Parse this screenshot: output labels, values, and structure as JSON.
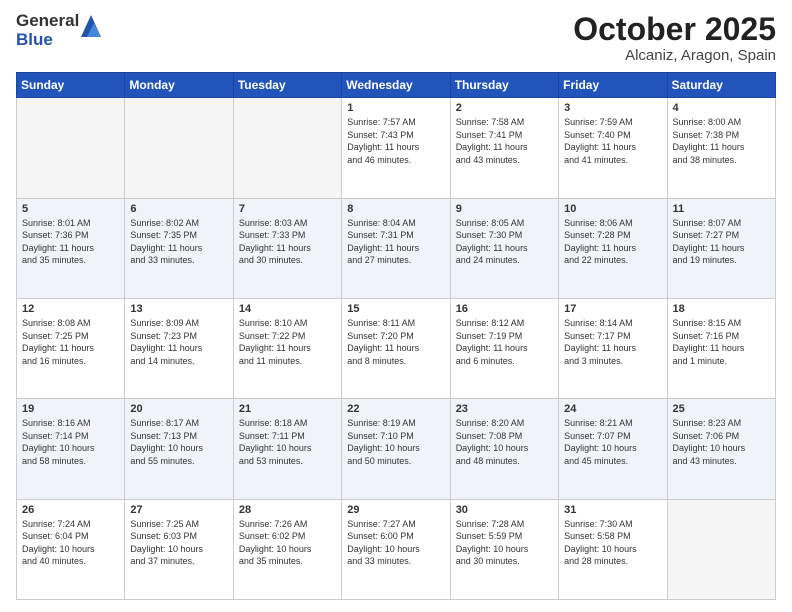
{
  "logo": {
    "general": "General",
    "blue": "Blue"
  },
  "title": {
    "month": "October 2025",
    "location": "Alcaniz, Aragon, Spain"
  },
  "weekdays": [
    "Sunday",
    "Monday",
    "Tuesday",
    "Wednesday",
    "Thursday",
    "Friday",
    "Saturday"
  ],
  "weeks": [
    [
      {
        "day": "",
        "info": ""
      },
      {
        "day": "",
        "info": ""
      },
      {
        "day": "",
        "info": ""
      },
      {
        "day": "1",
        "info": "Sunrise: 7:57 AM\nSunset: 7:43 PM\nDaylight: 11 hours\nand 46 minutes."
      },
      {
        "day": "2",
        "info": "Sunrise: 7:58 AM\nSunset: 7:41 PM\nDaylight: 11 hours\nand 43 minutes."
      },
      {
        "day": "3",
        "info": "Sunrise: 7:59 AM\nSunset: 7:40 PM\nDaylight: 11 hours\nand 41 minutes."
      },
      {
        "day": "4",
        "info": "Sunrise: 8:00 AM\nSunset: 7:38 PM\nDaylight: 11 hours\nand 38 minutes."
      }
    ],
    [
      {
        "day": "5",
        "info": "Sunrise: 8:01 AM\nSunset: 7:36 PM\nDaylight: 11 hours\nand 35 minutes."
      },
      {
        "day": "6",
        "info": "Sunrise: 8:02 AM\nSunset: 7:35 PM\nDaylight: 11 hours\nand 33 minutes."
      },
      {
        "day": "7",
        "info": "Sunrise: 8:03 AM\nSunset: 7:33 PM\nDaylight: 11 hours\nand 30 minutes."
      },
      {
        "day": "8",
        "info": "Sunrise: 8:04 AM\nSunset: 7:31 PM\nDaylight: 11 hours\nand 27 minutes."
      },
      {
        "day": "9",
        "info": "Sunrise: 8:05 AM\nSunset: 7:30 PM\nDaylight: 11 hours\nand 24 minutes."
      },
      {
        "day": "10",
        "info": "Sunrise: 8:06 AM\nSunset: 7:28 PM\nDaylight: 11 hours\nand 22 minutes."
      },
      {
        "day": "11",
        "info": "Sunrise: 8:07 AM\nSunset: 7:27 PM\nDaylight: 11 hours\nand 19 minutes."
      }
    ],
    [
      {
        "day": "12",
        "info": "Sunrise: 8:08 AM\nSunset: 7:25 PM\nDaylight: 11 hours\nand 16 minutes."
      },
      {
        "day": "13",
        "info": "Sunrise: 8:09 AM\nSunset: 7:23 PM\nDaylight: 11 hours\nand 14 minutes."
      },
      {
        "day": "14",
        "info": "Sunrise: 8:10 AM\nSunset: 7:22 PM\nDaylight: 11 hours\nand 11 minutes."
      },
      {
        "day": "15",
        "info": "Sunrise: 8:11 AM\nSunset: 7:20 PM\nDaylight: 11 hours\nand 8 minutes."
      },
      {
        "day": "16",
        "info": "Sunrise: 8:12 AM\nSunset: 7:19 PM\nDaylight: 11 hours\nand 6 minutes."
      },
      {
        "day": "17",
        "info": "Sunrise: 8:14 AM\nSunset: 7:17 PM\nDaylight: 11 hours\nand 3 minutes."
      },
      {
        "day": "18",
        "info": "Sunrise: 8:15 AM\nSunset: 7:16 PM\nDaylight: 11 hours\nand 1 minute."
      }
    ],
    [
      {
        "day": "19",
        "info": "Sunrise: 8:16 AM\nSunset: 7:14 PM\nDaylight: 10 hours\nand 58 minutes."
      },
      {
        "day": "20",
        "info": "Sunrise: 8:17 AM\nSunset: 7:13 PM\nDaylight: 10 hours\nand 55 minutes."
      },
      {
        "day": "21",
        "info": "Sunrise: 8:18 AM\nSunset: 7:11 PM\nDaylight: 10 hours\nand 53 minutes."
      },
      {
        "day": "22",
        "info": "Sunrise: 8:19 AM\nSunset: 7:10 PM\nDaylight: 10 hours\nand 50 minutes."
      },
      {
        "day": "23",
        "info": "Sunrise: 8:20 AM\nSunset: 7:08 PM\nDaylight: 10 hours\nand 48 minutes."
      },
      {
        "day": "24",
        "info": "Sunrise: 8:21 AM\nSunset: 7:07 PM\nDaylight: 10 hours\nand 45 minutes."
      },
      {
        "day": "25",
        "info": "Sunrise: 8:23 AM\nSunset: 7:06 PM\nDaylight: 10 hours\nand 43 minutes."
      }
    ],
    [
      {
        "day": "26",
        "info": "Sunrise: 7:24 AM\nSunset: 6:04 PM\nDaylight: 10 hours\nand 40 minutes."
      },
      {
        "day": "27",
        "info": "Sunrise: 7:25 AM\nSunset: 6:03 PM\nDaylight: 10 hours\nand 37 minutes."
      },
      {
        "day": "28",
        "info": "Sunrise: 7:26 AM\nSunset: 6:02 PM\nDaylight: 10 hours\nand 35 minutes."
      },
      {
        "day": "29",
        "info": "Sunrise: 7:27 AM\nSunset: 6:00 PM\nDaylight: 10 hours\nand 33 minutes."
      },
      {
        "day": "30",
        "info": "Sunrise: 7:28 AM\nSunset: 5:59 PM\nDaylight: 10 hours\nand 30 minutes."
      },
      {
        "day": "31",
        "info": "Sunrise: 7:30 AM\nSunset: 5:58 PM\nDaylight: 10 hours\nand 28 minutes."
      },
      {
        "day": "",
        "info": ""
      }
    ]
  ]
}
